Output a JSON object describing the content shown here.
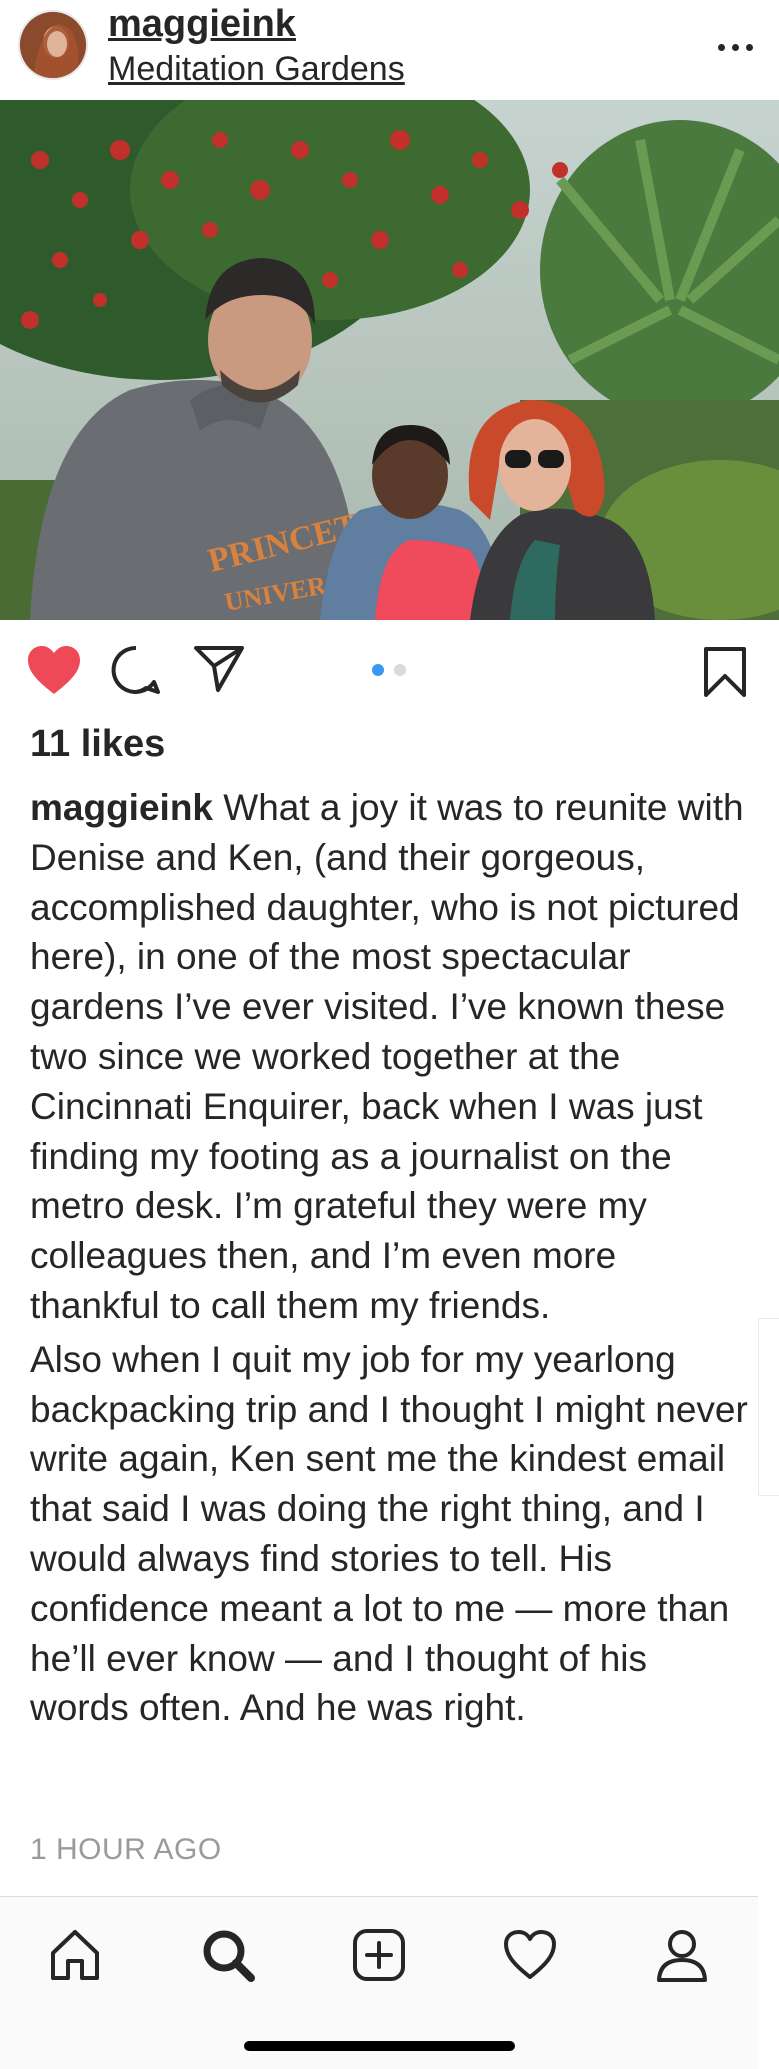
{
  "header": {
    "username": "maggieink",
    "location": "Meditation Gardens",
    "avatar_icon": "profile-avatar",
    "more_icon": "more-horizontal-icon"
  },
  "post": {
    "image_icon": "post-photo",
    "carousel": {
      "count": 2,
      "active_index": 0,
      "active_color": "#3897f0",
      "inactive_color": "#dbdbdb"
    },
    "actions": {
      "like_icon": "heart-filled-icon",
      "like_color": "#ed4956",
      "comment_icon": "comment-icon",
      "share_icon": "send-icon",
      "save_icon": "bookmark-icon"
    },
    "likes": "11 likes",
    "caption_user": "maggieink",
    "caption_text": "What a joy it was to reunite with Denise and Ken, (and their gorgeous, accomplished daughter, who is not pictured here), in one of the most spectacular gardens I’ve ever visited. I’ve known these two since we worked together at the Cincinnati Enquirer, back when I was just finding my footing as a journalist on the metro desk. I’m grateful they were my colleagues then, and I’m even more thankful to call them my friends.",
    "caption_text_2": "Also when I quit my job for my yearlong backpacking trip and I thought I might never write again, Ken sent me the kindest email that said I was doing the right thing, and I would always find stories to tell. His confidence meant a lot to me — more than he’ll ever know — and I thought of his words often. And he was right.",
    "timestamp": "1 HOUR AGO"
  },
  "tabbar": {
    "items": [
      {
        "name": "home",
        "icon": "home-icon"
      },
      {
        "name": "search",
        "icon": "search-icon"
      },
      {
        "name": "new-post",
        "icon": "add-post-icon"
      },
      {
        "name": "activity",
        "icon": "heart-outline-icon"
      },
      {
        "name": "profile",
        "icon": "profile-icon"
      }
    ]
  }
}
